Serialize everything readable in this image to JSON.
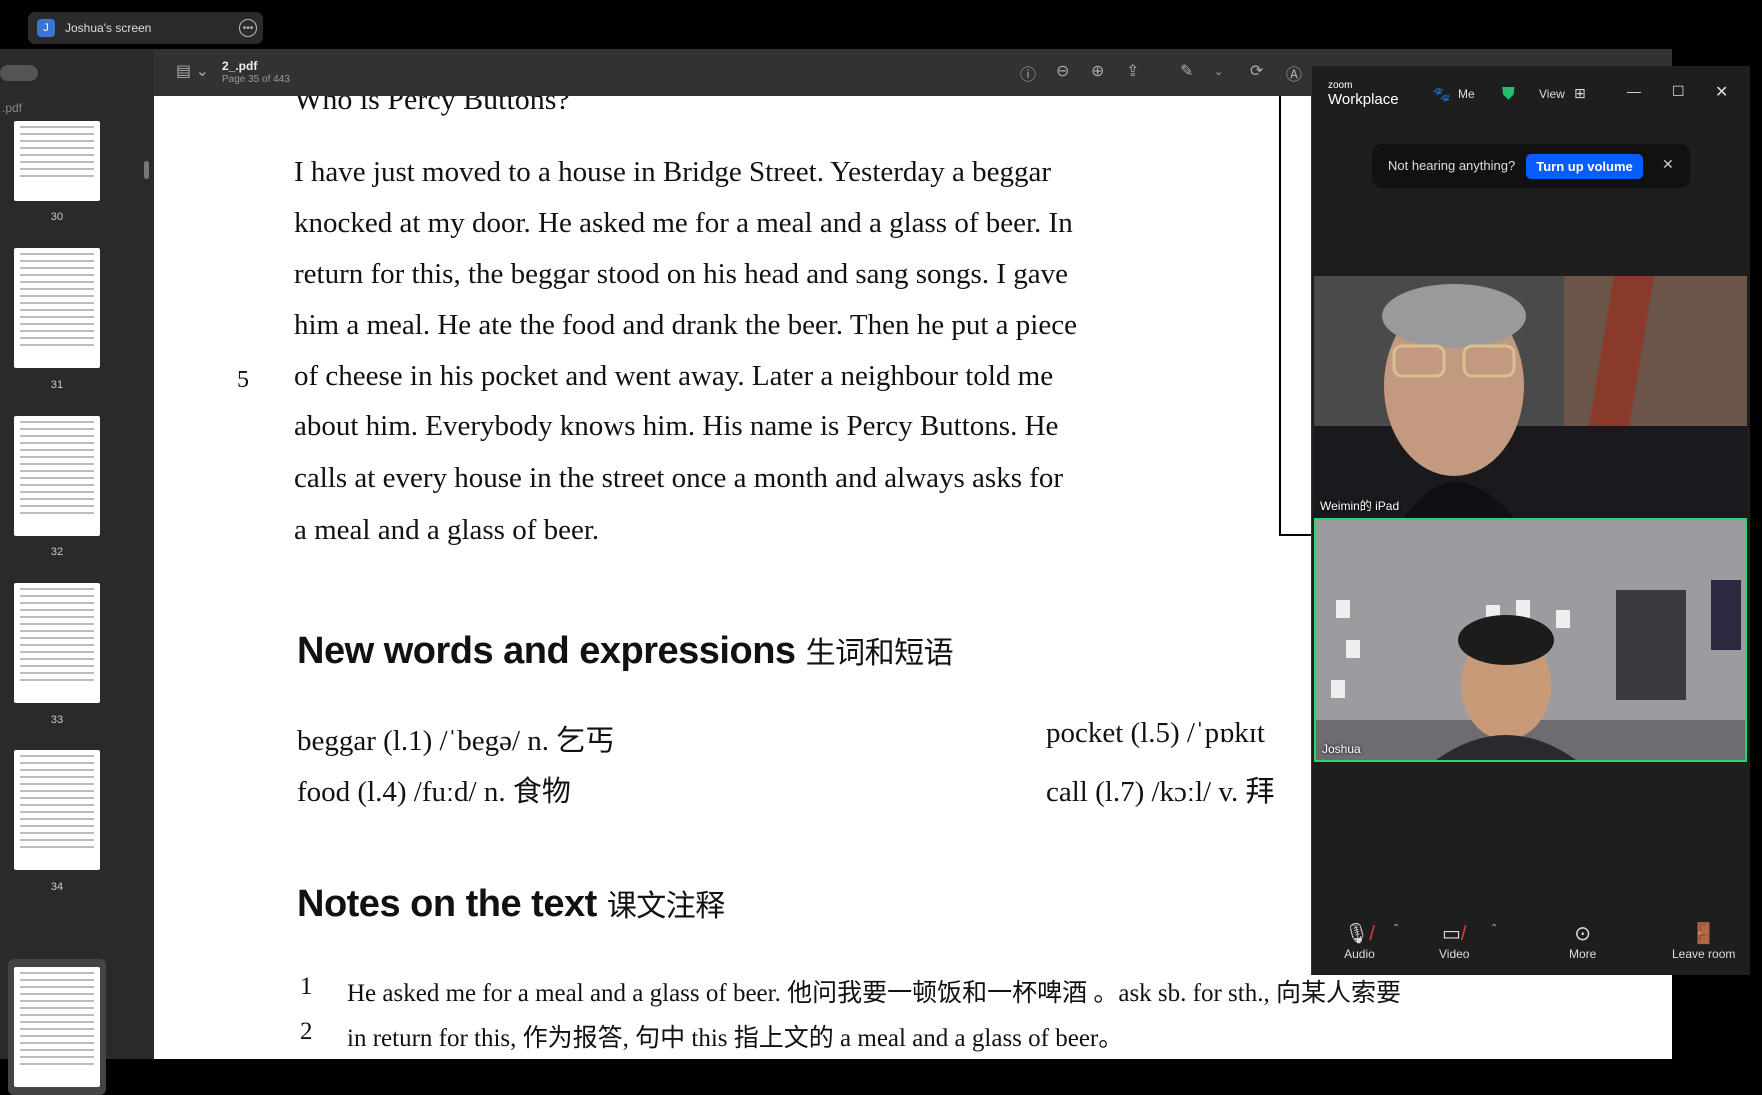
{
  "share": {
    "avatar": "J",
    "title": "Joshua's screen"
  },
  "sidebar": {
    "filename": ".pdf",
    "thumbs": [
      {
        "label": "30"
      },
      {
        "label": "31"
      },
      {
        "label": "32"
      },
      {
        "label": "33"
      },
      {
        "label": "34"
      },
      {
        "label": ""
      }
    ]
  },
  "toolbar": {
    "doc_name": "2_.pdf",
    "page_info": "Page 35 of 443"
  },
  "pdf": {
    "title_partial": "Who is Percy Buttons?",
    "lines": [
      "I have just moved to a house in Bridge Street. Yesterday a beggar",
      "knocked at my door. He asked me for a meal and a glass of beer. In",
      "return for this, the beggar stood on his head and sang songs. I gave",
      "him a meal. He ate the food and drank the beer. Then he put a piece",
      "of cheese in his pocket and went away. Later a neighbour told me",
      "about him. Everybody knows him. His name is Percy Buttons. He",
      "calls at every house in the street once a month and always asks for",
      "a meal and a glass of beer."
    ],
    "line_number": "5",
    "new_words_heading": "New words and expressions",
    "new_words_heading_cn": "生词和短语",
    "vocab": [
      "beggar (l.1) /ˈbegə/ n. 乞丐",
      "food (l.4) /fuːd/ n. 食物",
      "pocket (l.5) /ˈpɒkɪt",
      "call (l.7) /kɔːl/ v. 拜"
    ],
    "notes_heading": "Notes on the text",
    "notes_heading_cn": "课文注释",
    "notes": [
      {
        "num": "1",
        "text": "He asked me for a meal and a glass of beer. 他问我要一顿饭和一杯啤酒 。ask sb. for sth., 向某人索要"
      },
      {
        "num": "2",
        "text": "in return for this, 作为报答, 句中 this 指上文的 a meal and a glass of beer。"
      }
    ]
  },
  "zoom": {
    "logo_top": "zoom",
    "logo": "Workplace",
    "me_label": "Me",
    "view_label": "View",
    "notice_text": "Not hearing anything?",
    "notice_button": "Turn up volume",
    "participants": [
      {
        "name": "Weimin的 iPad"
      },
      {
        "name": "Joshua"
      }
    ],
    "controls": {
      "audio": "Audio",
      "video": "Video",
      "more": "More",
      "leave": "Leave room"
    }
  }
}
